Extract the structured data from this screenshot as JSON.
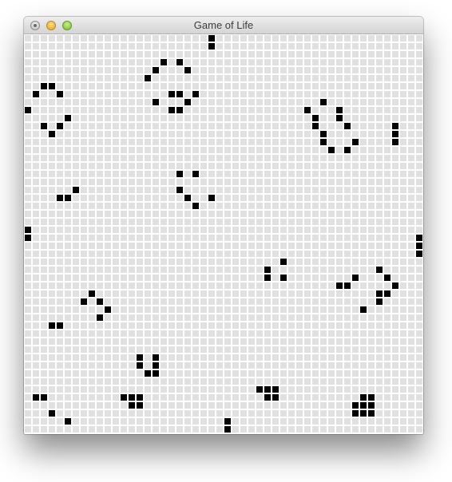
{
  "window": {
    "title": "Game of Life"
  },
  "colors": {
    "dead_cell": "#e0e0e0",
    "alive_cell": "#000000",
    "grid_line": "#ffffff"
  },
  "board": {
    "columns": 50,
    "rows": 50,
    "alive_cells": [
      [
        23,
        0
      ],
      [
        23,
        1
      ],
      [
        17,
        3
      ],
      [
        19,
        3
      ],
      [
        16,
        4
      ],
      [
        20,
        4
      ],
      [
        15,
        5
      ],
      [
        2,
        6
      ],
      [
        3,
        6
      ],
      [
        1,
        7
      ],
      [
        4,
        7
      ],
      [
        18,
        7
      ],
      [
        19,
        7
      ],
      [
        21,
        7
      ],
      [
        16,
        8
      ],
      [
        20,
        8
      ],
      [
        37,
        8
      ],
      [
        0,
        9
      ],
      [
        18,
        9
      ],
      [
        19,
        9
      ],
      [
        35,
        9
      ],
      [
        39,
        9
      ],
      [
        5,
        10
      ],
      [
        36,
        10
      ],
      [
        39,
        10
      ],
      [
        2,
        11
      ],
      [
        4,
        11
      ],
      [
        36,
        11
      ],
      [
        40,
        11
      ],
      [
        46,
        11
      ],
      [
        3,
        12
      ],
      [
        37,
        12
      ],
      [
        46,
        12
      ],
      [
        37,
        13
      ],
      [
        41,
        13
      ],
      [
        46,
        13
      ],
      [
        38,
        14
      ],
      [
        40,
        14
      ],
      [
        19,
        17
      ],
      [
        21,
        17
      ],
      [
        6,
        19
      ],
      [
        19,
        19
      ],
      [
        4,
        20
      ],
      [
        5,
        20
      ],
      [
        20,
        20
      ],
      [
        23,
        20
      ],
      [
        21,
        21
      ],
      [
        0,
        24
      ],
      [
        0,
        25
      ],
      [
        49,
        25
      ],
      [
        49,
        26
      ],
      [
        49,
        27
      ],
      [
        32,
        28
      ],
      [
        30,
        29
      ],
      [
        44,
        29
      ],
      [
        30,
        30
      ],
      [
        32,
        30
      ],
      [
        41,
        30
      ],
      [
        45,
        30
      ],
      [
        39,
        31
      ],
      [
        40,
        31
      ],
      [
        46,
        31
      ],
      [
        8,
        32
      ],
      [
        44,
        32
      ],
      [
        45,
        32
      ],
      [
        7,
        33
      ],
      [
        9,
        33
      ],
      [
        44,
        33
      ],
      [
        10,
        34
      ],
      [
        42,
        34
      ],
      [
        9,
        35
      ],
      [
        3,
        36
      ],
      [
        4,
        36
      ],
      [
        14,
        40
      ],
      [
        16,
        40
      ],
      [
        14,
        41
      ],
      [
        16,
        41
      ],
      [
        15,
        42
      ],
      [
        16,
        42
      ],
      [
        29,
        44
      ],
      [
        30,
        44
      ],
      [
        31,
        44
      ],
      [
        1,
        45
      ],
      [
        2,
        45
      ],
      [
        12,
        45
      ],
      [
        13,
        45
      ],
      [
        14,
        45
      ],
      [
        30,
        45
      ],
      [
        31,
        45
      ],
      [
        42,
        45
      ],
      [
        43,
        45
      ],
      [
        13,
        46
      ],
      [
        14,
        46
      ],
      [
        41,
        46
      ],
      [
        42,
        46
      ],
      [
        43,
        46
      ],
      [
        3,
        47
      ],
      [
        41,
        47
      ],
      [
        42,
        47
      ],
      [
        43,
        47
      ],
      [
        5,
        48
      ],
      [
        25,
        48
      ],
      [
        25,
        49
      ]
    ]
  }
}
